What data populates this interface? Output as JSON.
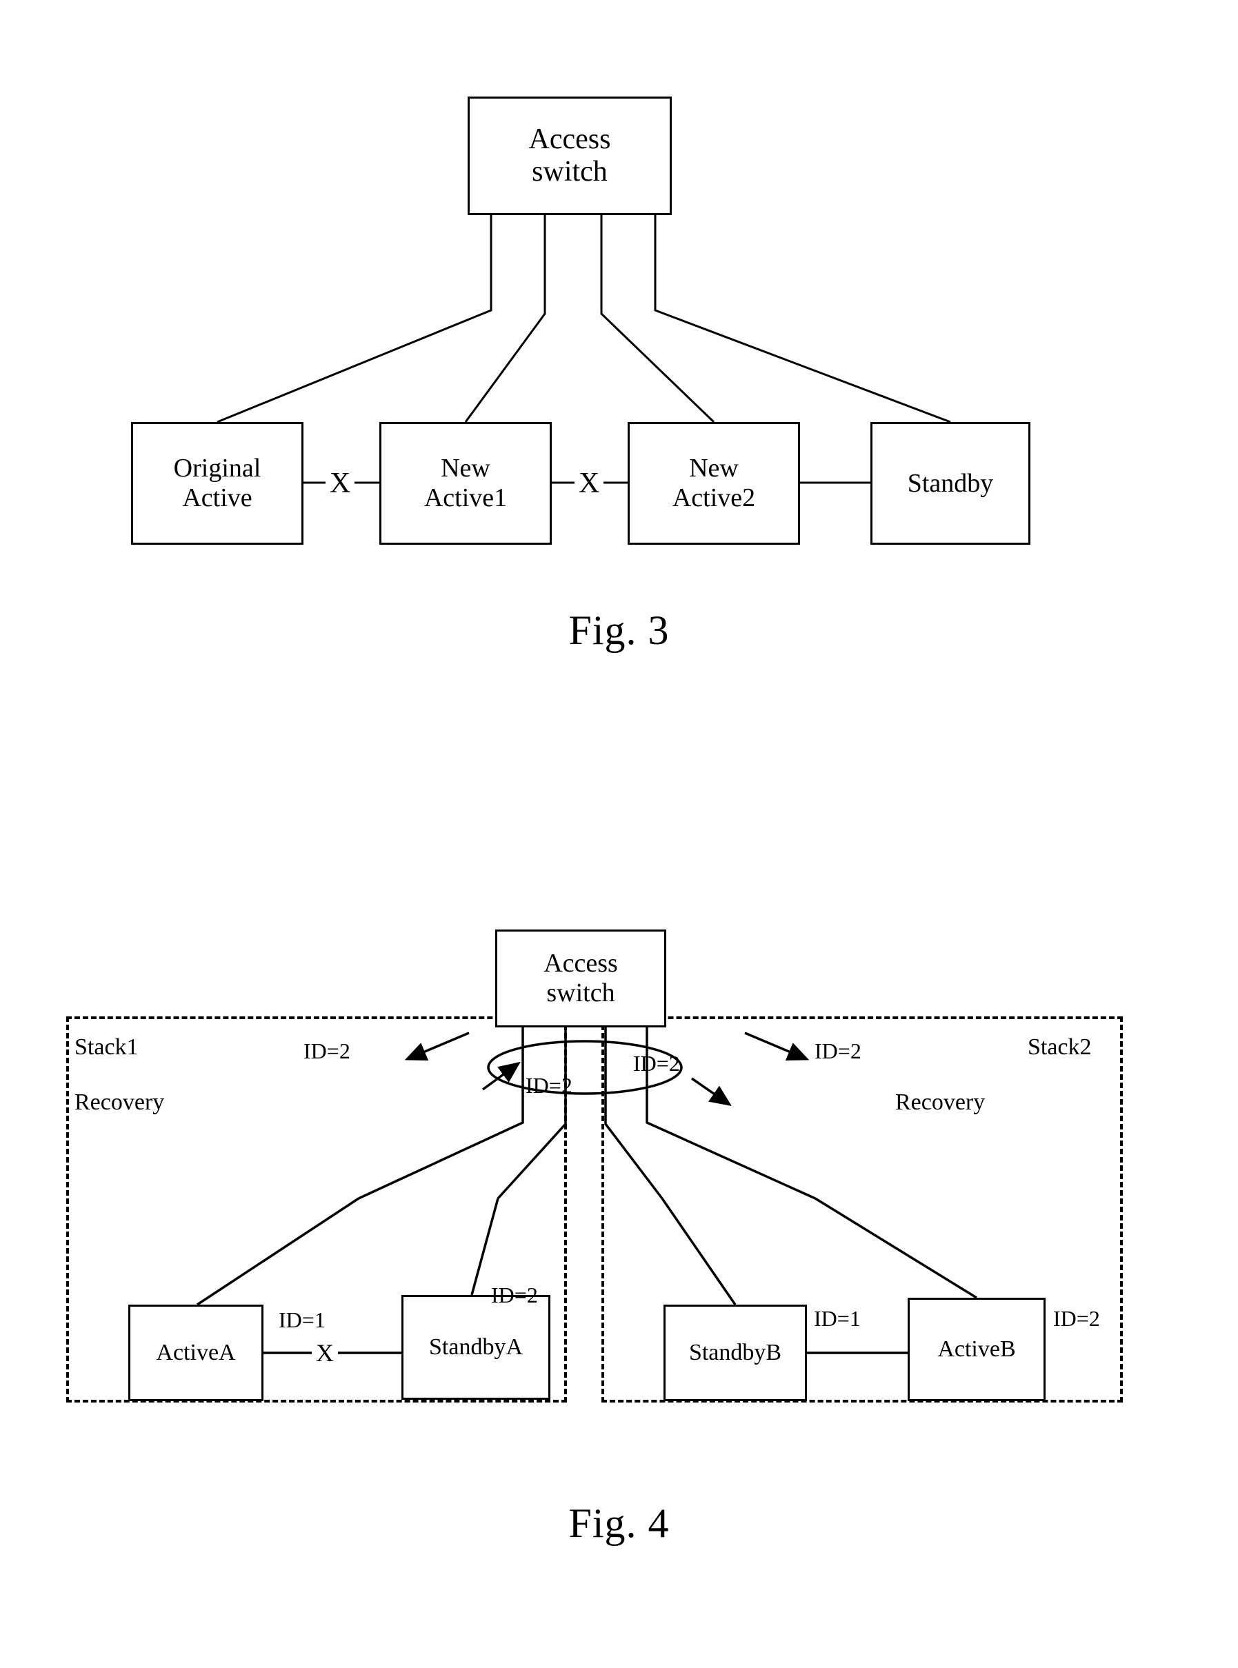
{
  "document": {
    "type": "patent-drawing-sheet",
    "figures": [
      "Fig. 3",
      "Fig. 4"
    ]
  },
  "fig3": {
    "caption": "Fig. 3",
    "access_switch": "Access\nswitch",
    "nodes": [
      {
        "id": "original-active",
        "label": "Original\nActive"
      },
      {
        "id": "new-active1",
        "label": "New\nActive1"
      },
      {
        "id": "new-active2",
        "label": "New\nActive2"
      },
      {
        "id": "standby",
        "label": "Standby"
      }
    ],
    "link_markers": [
      {
        "id": "x-orig-new1",
        "label": "X"
      },
      {
        "id": "x-new1-new2",
        "label": "X"
      }
    ]
  },
  "fig4": {
    "caption": "Fig. 4",
    "access_switch": "Access\nswitch",
    "stacks": [
      {
        "id": "stack1",
        "title": "Stack1",
        "state": "Recovery"
      },
      {
        "id": "stack2",
        "title": "Stack2",
        "state": "Recovery"
      }
    ],
    "nodes": [
      {
        "id": "activeA",
        "label": "ActiveA",
        "id_label": "ID=1"
      },
      {
        "id": "standbyA",
        "label": "StandbyA",
        "id_label": "ID=2"
      },
      {
        "id": "standbyB",
        "label": "StandbyB",
        "id_label": "ID=1"
      },
      {
        "id": "activeB",
        "label": "ActiveB",
        "id_label": "ID=2"
      }
    ],
    "link_markers": [
      {
        "id": "x-activeA-standbyA",
        "label": "X"
      }
    ],
    "uplink_labels": [
      {
        "id": "uplink-left",
        "label": "ID=2"
      },
      {
        "id": "uplink-center-left",
        "label": "ID=2"
      },
      {
        "id": "uplink-center-right",
        "label": "ID=2"
      },
      {
        "id": "uplink-right",
        "label": "ID=2"
      }
    ]
  },
  "colors": {
    "ink": "#000000",
    "paper": "#ffffff"
  }
}
